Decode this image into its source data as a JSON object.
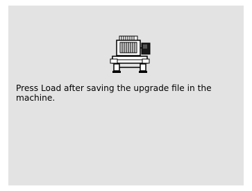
{
  "dialog": {
    "icon": "embroidery-machine-icon",
    "message": "Press Load after saving the upgrade file in the\nmachine."
  },
  "colors": {
    "screen_background": "#e3e3e3",
    "page_background": "#ffffff",
    "text": "#000000"
  }
}
